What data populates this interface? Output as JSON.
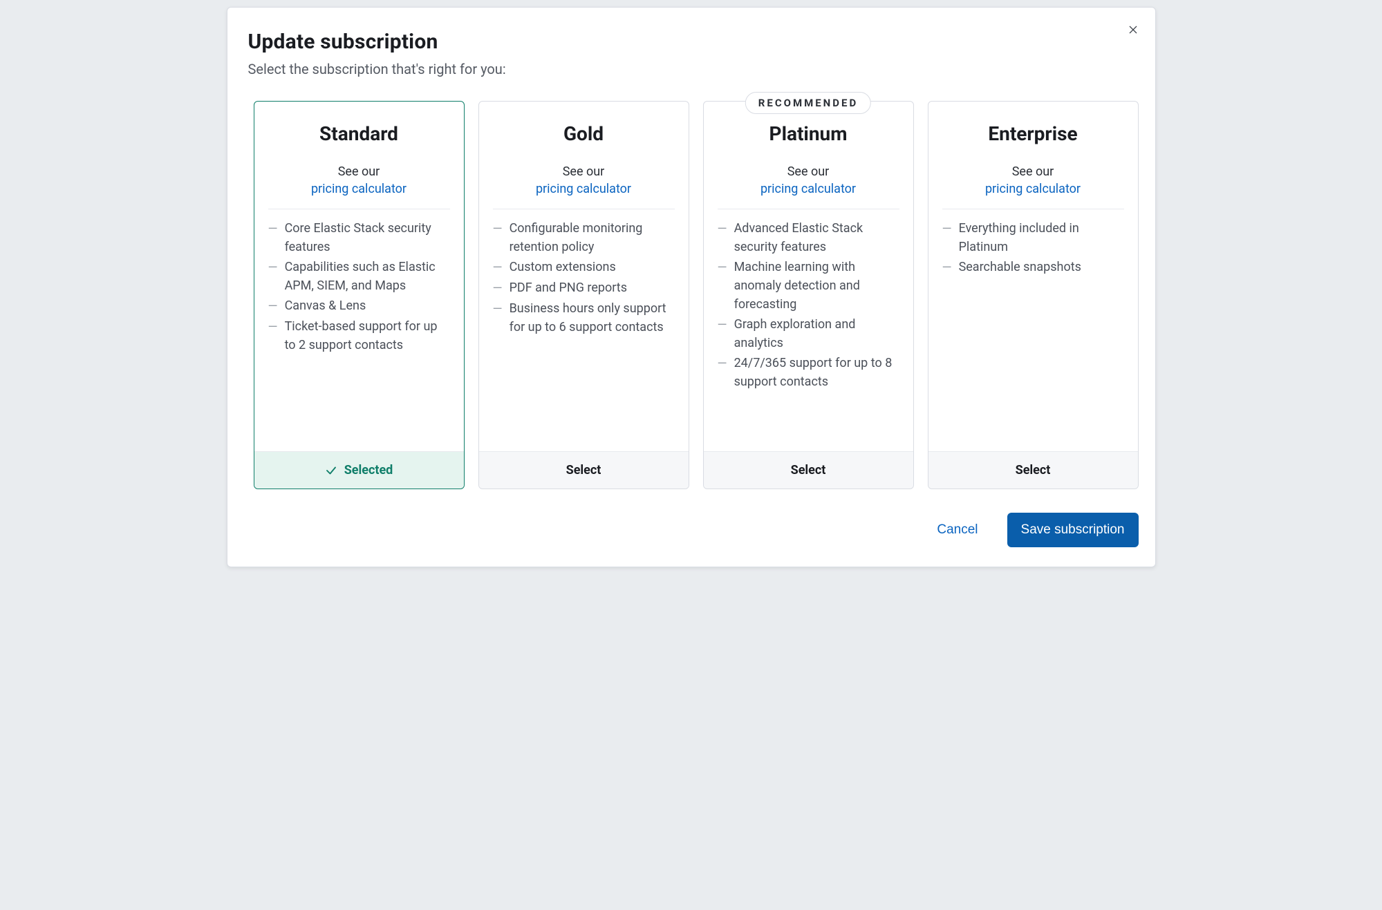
{
  "modal": {
    "title": "Update subscription",
    "subtitle": "Select the subscription that's right for you:",
    "recommended_badge": "RECOMMENDED",
    "see_our_label": "See our",
    "pricing_link_label": "pricing calculator",
    "selected_label": "Selected",
    "select_label": "Select",
    "plans": [
      {
        "name": "Standard",
        "selected": true,
        "recommended": false,
        "features": [
          "Core Elastic Stack security features",
          "Capabilities such as Elastic APM, SIEM, and Maps",
          "Canvas & Lens",
          "Ticket-based support for up to 2 support contacts"
        ]
      },
      {
        "name": "Gold",
        "selected": false,
        "recommended": false,
        "features": [
          "Configurable monitoring retention policy",
          "Custom extensions",
          "PDF and PNG reports",
          "Business hours only support for up to 6 support contacts"
        ]
      },
      {
        "name": "Platinum",
        "selected": false,
        "recommended": true,
        "features": [
          "Advanced Elastic Stack security features",
          "Machine learning with anomaly detection and forecasting",
          "Graph exploration and analytics",
          "24/7/365 support for up to 8 support contacts"
        ]
      },
      {
        "name": "Enterprise",
        "selected": false,
        "recommended": false,
        "features": [
          "Everything included in Platinum",
          "Searchable snapshots"
        ]
      }
    ],
    "actions": {
      "cancel": "Cancel",
      "save": "Save subscription"
    }
  }
}
